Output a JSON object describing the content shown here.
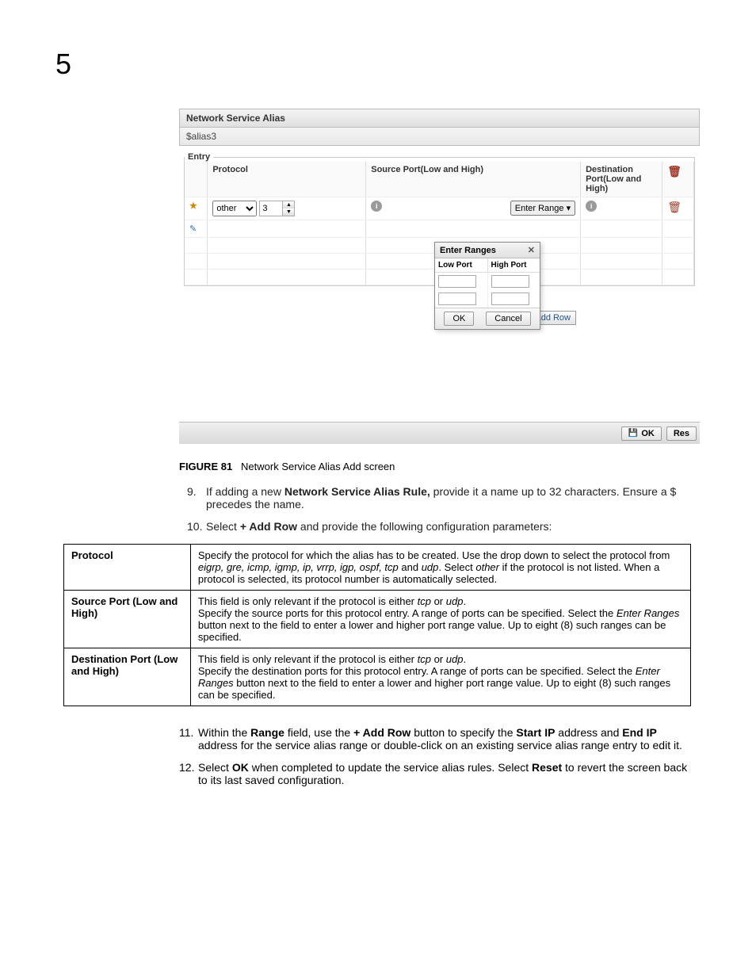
{
  "page_number": "5",
  "panel": {
    "title": "Network Service Alias",
    "alias_value": "$alias3",
    "fieldset_label": "Entry",
    "columns": {
      "protocol": "Protocol",
      "source_port": "Source Port(Low and High)",
      "dest_port": "Destination Port(Low and High)"
    },
    "row1": {
      "proto_select": "other",
      "proto_num": "3",
      "enter_range_label": "Enter Range"
    },
    "popover": {
      "title": "Enter Ranges",
      "low_col": "Low Port",
      "high_col": "High Port",
      "ok": "OK",
      "cancel": "Cancel"
    },
    "add_row": "Add Row"
  },
  "bottom": {
    "ok": "OK",
    "reset": "Res"
  },
  "figure": {
    "label": "FIGURE 81",
    "caption": "Network Service Alias Add screen"
  },
  "steps_a": [
    {
      "num": "9.",
      "pre": "If adding a new ",
      "bold": "Network Service Alias Rule,",
      "post": " provide it a name up to 32 characters. Ensure a $ precedes the name."
    },
    {
      "num": "10.",
      "pre": "Select ",
      "bold": "+ Add Row",
      "post": " and provide the following configuration parameters:"
    }
  ],
  "params": {
    "row1": {
      "name": "Protocol",
      "d1": "Specify the protocol for which the alias has to be created. Use the drop down to select the protocol from ",
      "i1": "eigrp, gre, icmp, igmp, ip, vrrp, igp, ospf, tcp",
      "d2": " and ",
      "i2": "udp",
      "d3": ". Select ",
      "i3": "other",
      "d4": " if the protocol is not listed. When a protocol is selected, its protocol number is automatically selected."
    },
    "row2": {
      "name": "Source Port (Low and High)",
      "d1": "This field is only relevant if the protocol is either ",
      "i1": "tcp",
      "d2": " or ",
      "i2": "udp",
      "d3": ".",
      "d4": "Specify the source ports for this protocol entry. A range of ports can be specified. Select the ",
      "i3": "Enter Ranges",
      "d5": " button next to the field to enter a lower and higher port range value. Up to eight (8) such ranges can be specified."
    },
    "row3": {
      "name": "Destination Port (Low and High)",
      "d1": "This field is only relevant if the protocol is either ",
      "i1": "tcp",
      "d2": " or ",
      "i2": "udp",
      "d3": ".",
      "d4": "Specify the destination ports for this protocol entry. A range of ports can be specified. Select the ",
      "i3": "Enter Ranges",
      "d5": " button next to the field to enter a lower and higher port range value. Up to eight (8) such ranges can be specified."
    }
  },
  "steps_b": [
    {
      "num": "11.",
      "p1": "Within the ",
      "b1": "Range",
      "p2": " field, use the ",
      "b2": "+ Add Row",
      "p3": " button to specify the ",
      "b3": "Start IP",
      "p4": " address and ",
      "b4": "End IP",
      "p5": " address for the service alias range or double-click on an existing service alias range entry to edit it."
    },
    {
      "num": "12.",
      "p1": "Select ",
      "b1": "OK",
      "p2": " when completed to update the service alias rules. Select ",
      "b2": "Reset",
      "p3": " to revert the screen back to its last saved configuration."
    }
  ]
}
